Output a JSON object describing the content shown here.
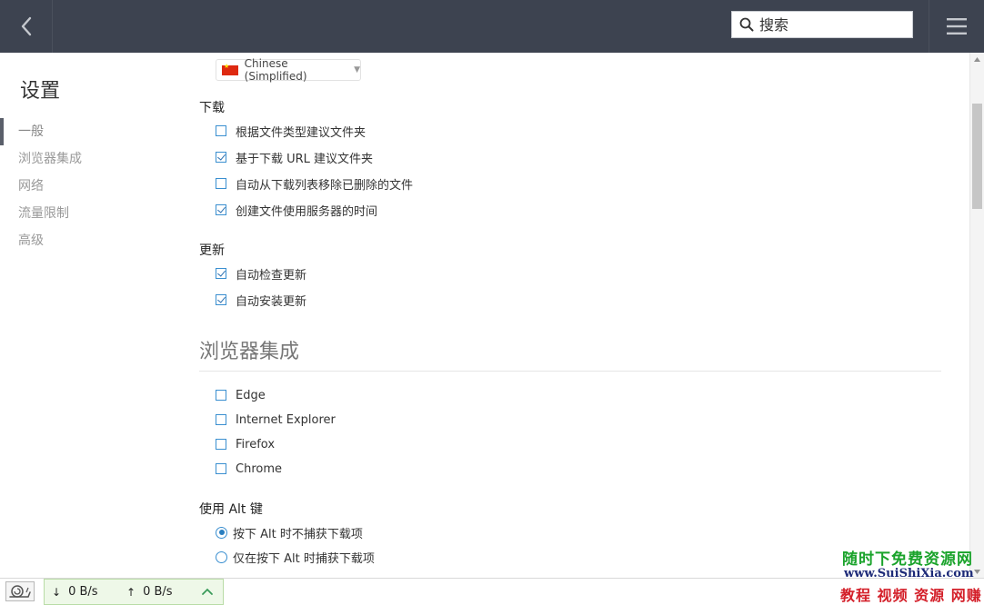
{
  "header": {
    "search_placeholder": "搜索"
  },
  "sidebar": {
    "title": "设置",
    "items": [
      {
        "label": "一般"
      },
      {
        "label": "浏览器集成"
      },
      {
        "label": "网络"
      },
      {
        "label": "流量限制"
      },
      {
        "label": "高级"
      }
    ],
    "active_index": 0
  },
  "content": {
    "language": "Chinese (Simplified)",
    "download": {
      "title": "下载",
      "options": [
        {
          "label": "根据文件类型建议文件夹",
          "checked": false
        },
        {
          "label": "基于下载 URL 建议文件夹",
          "checked": true
        },
        {
          "label": "自动从下载列表移除已删除的文件",
          "checked": false
        },
        {
          "label": "创建文件使用服务器的时间",
          "checked": true
        }
      ]
    },
    "update": {
      "title": "更新",
      "options": [
        {
          "label": "自动检查更新",
          "checked": true
        },
        {
          "label": "自动安装更新",
          "checked": true
        }
      ]
    },
    "browser_integration": {
      "title": "浏览器集成",
      "browsers": [
        {
          "label": "Edge",
          "checked": false
        },
        {
          "label": "Internet Explorer",
          "checked": false
        },
        {
          "label": "Firefox",
          "checked": false
        },
        {
          "label": "Chrome",
          "checked": false
        }
      ]
    },
    "alt_key": {
      "title": "使用 Alt 键",
      "options": [
        {
          "label": "按下 Alt 时不捕获下载项",
          "selected": true
        },
        {
          "label": "仅在按下 Alt 时捕获下载项",
          "selected": false
        }
      ]
    }
  },
  "statusbar": {
    "download_speed": "0 B/s",
    "upload_speed": "0 B/s"
  },
  "watermark": {
    "line1": "随时下免费资源网",
    "line2": "www.SuiShiXia.com",
    "line3": "教程 视频 资源 网赚"
  },
  "colors": {
    "topbar": "#3d4350",
    "accent": "#3a8fd0",
    "speed_panel": "#eef8e8"
  }
}
